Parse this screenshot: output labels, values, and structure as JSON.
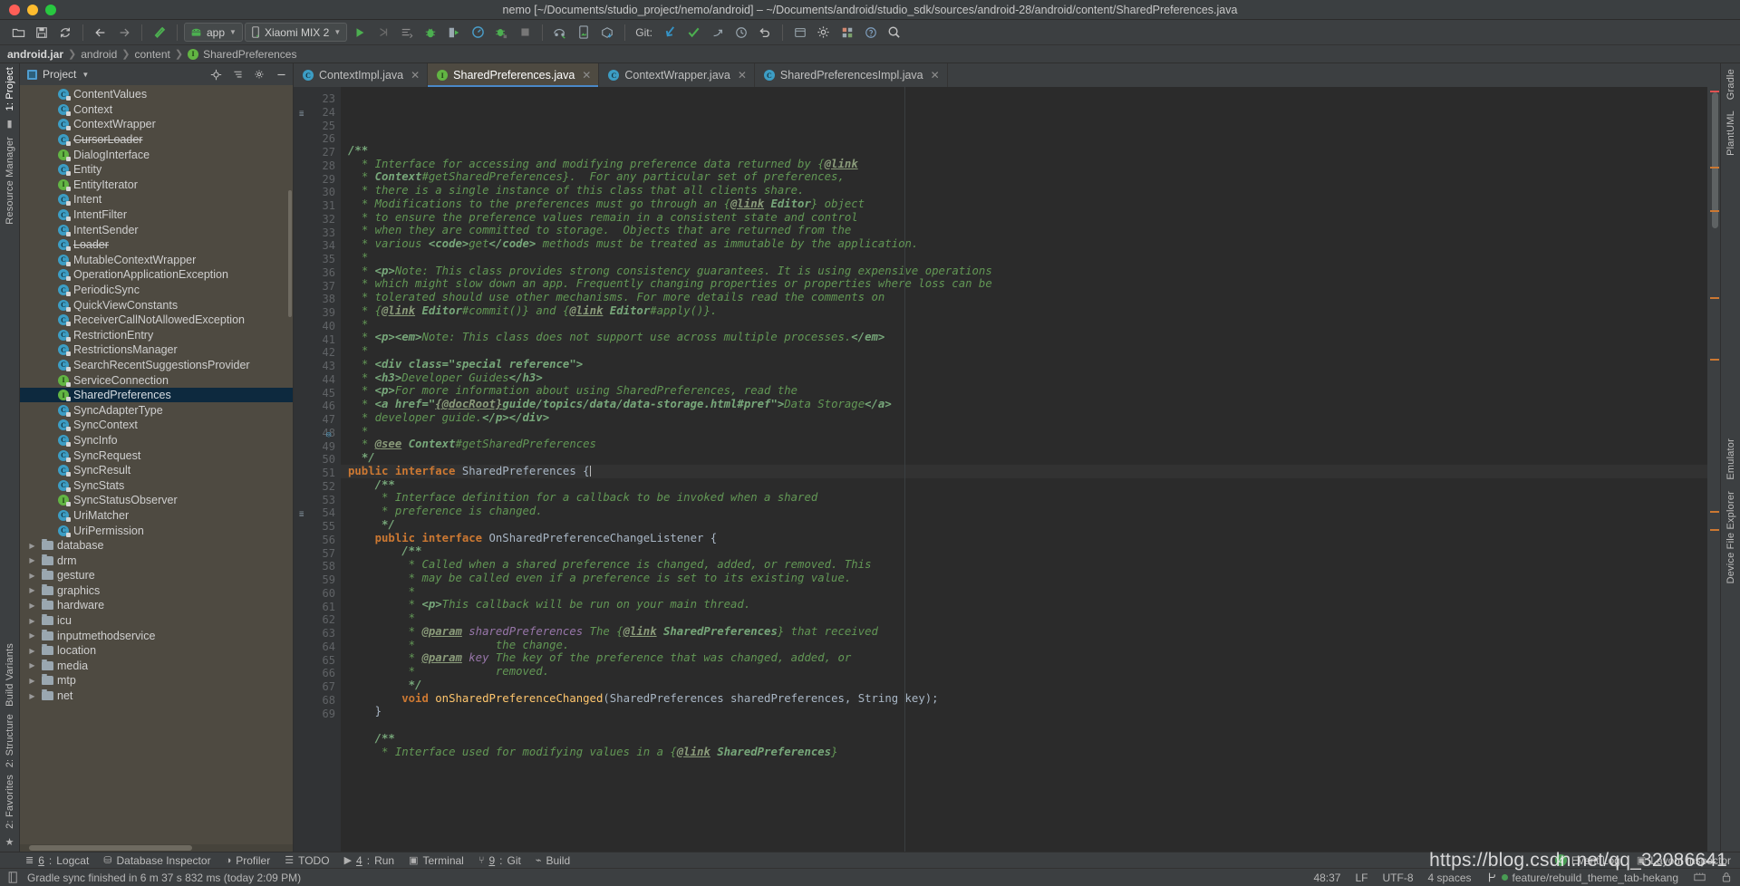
{
  "window": {
    "title": "nemo [~/Documents/studio_project/nemo/android] – ~/Documents/android/studio_sdk/sources/android-28/android/content/SharedPreferences.java"
  },
  "toolbar": {
    "icons": [
      "open-folder-icon",
      "save-icon",
      "sync-icon",
      "back-arrow-icon",
      "forward-arrow-icon",
      "build-hammer-icon"
    ],
    "module_selector": "app",
    "device_selector": "Xiaomi MIX 2",
    "run_icons": [
      "run-icon",
      "apply-changes-icon",
      "run-with-coverage-icon",
      "debug-icon",
      "attach-debugger-icon",
      "profiler-icon",
      "attach-debugger-android-icon",
      "stop-icon"
    ],
    "sdk_icons": [
      "sdk-manager-icon",
      "avd-manager-icon",
      "device-file-icon"
    ],
    "git_label": "Git:",
    "git_icons": [
      "update-project-icon",
      "commit-icon",
      "push-icon",
      "history-icon",
      "rollback-icon"
    ],
    "right_icons": [
      "search-everywhere-icon",
      "settings-gear-icon",
      "project-structure-icon",
      "help-icon",
      "search-icon"
    ]
  },
  "breadcrumb": {
    "items": [
      "android.jar",
      "android",
      "content",
      "SharedPreferences"
    ],
    "leaf_icon": "interface-icon"
  },
  "left_rail": {
    "top": [
      "1: Project",
      "Resource Manager"
    ],
    "bottom": [
      "Build Variants",
      "2: Structure",
      "2: Favorites"
    ]
  },
  "right_rail": {
    "items": [
      "Gradle",
      "PlantUML",
      "Emulator",
      "Device File Explorer"
    ]
  },
  "project_panel": {
    "title": "Project",
    "header_icons": [
      "locate-icon",
      "collapse-all-icon",
      "settings-icon",
      "hide-icon"
    ],
    "tree": [
      {
        "label": "ContentValues",
        "kind": "class",
        "indent": 2
      },
      {
        "label": "Context",
        "kind": "class",
        "indent": 2
      },
      {
        "label": "ContextWrapper",
        "kind": "class",
        "indent": 2
      },
      {
        "label": "CursorLoader",
        "kind": "class",
        "indent": 2,
        "deprecated": true
      },
      {
        "label": "DialogInterface",
        "kind": "interface",
        "indent": 2
      },
      {
        "label": "Entity",
        "kind": "class",
        "indent": 2
      },
      {
        "label": "EntityIterator",
        "kind": "interface",
        "indent": 2
      },
      {
        "label": "Intent",
        "kind": "class",
        "indent": 2
      },
      {
        "label": "IntentFilter",
        "kind": "class",
        "indent": 2
      },
      {
        "label": "IntentSender",
        "kind": "class",
        "indent": 2
      },
      {
        "label": "Loader",
        "kind": "class",
        "indent": 2,
        "deprecated": true
      },
      {
        "label": "MutableContextWrapper",
        "kind": "class",
        "indent": 2
      },
      {
        "label": "OperationApplicationException",
        "kind": "class",
        "indent": 2
      },
      {
        "label": "PeriodicSync",
        "kind": "class",
        "indent": 2
      },
      {
        "label": "QuickViewConstants",
        "kind": "class",
        "indent": 2
      },
      {
        "label": "ReceiverCallNotAllowedException",
        "kind": "class",
        "indent": 2
      },
      {
        "label": "RestrictionEntry",
        "kind": "class",
        "indent": 2
      },
      {
        "label": "RestrictionsManager",
        "kind": "class",
        "indent": 2
      },
      {
        "label": "SearchRecentSuggestionsProvider",
        "kind": "class",
        "indent": 2
      },
      {
        "label": "ServiceConnection",
        "kind": "interface",
        "indent": 2
      },
      {
        "label": "SharedPreferences",
        "kind": "interface",
        "indent": 2,
        "selected": true
      },
      {
        "label": "SyncAdapterType",
        "kind": "class",
        "indent": 2
      },
      {
        "label": "SyncContext",
        "kind": "class",
        "indent": 2
      },
      {
        "label": "SyncInfo",
        "kind": "class",
        "indent": 2
      },
      {
        "label": "SyncRequest",
        "kind": "class",
        "indent": 2
      },
      {
        "label": "SyncResult",
        "kind": "class",
        "indent": 2
      },
      {
        "label": "SyncStats",
        "kind": "class",
        "indent": 2
      },
      {
        "label": "SyncStatusObserver",
        "kind": "interface",
        "indent": 2
      },
      {
        "label": "UriMatcher",
        "kind": "class",
        "indent": 2
      },
      {
        "label": "UriPermission",
        "kind": "class",
        "indent": 2
      },
      {
        "label": "database",
        "kind": "folder",
        "indent": 1,
        "expandable": true
      },
      {
        "label": "drm",
        "kind": "folder",
        "indent": 1,
        "expandable": true
      },
      {
        "label": "gesture",
        "kind": "folder",
        "indent": 1,
        "expandable": true
      },
      {
        "label": "graphics",
        "kind": "folder",
        "indent": 1,
        "expandable": true
      },
      {
        "label": "hardware",
        "kind": "folder",
        "indent": 1,
        "expandable": true
      },
      {
        "label": "icu",
        "kind": "folder",
        "indent": 1,
        "expandable": true
      },
      {
        "label": "inputmethodservice",
        "kind": "folder",
        "indent": 1,
        "expandable": true
      },
      {
        "label": "location",
        "kind": "folder",
        "indent": 1,
        "expandable": true
      },
      {
        "label": "media",
        "kind": "folder",
        "indent": 1,
        "expandable": true
      },
      {
        "label": "mtp",
        "kind": "folder",
        "indent": 1,
        "expandable": true
      },
      {
        "label": "net",
        "kind": "folder",
        "indent": 1,
        "expandable": true
      }
    ]
  },
  "editor_tabs": [
    {
      "label": "ContextImpl.java",
      "kind": "class",
      "active": false
    },
    {
      "label": "SharedPreferences.java",
      "kind": "interface",
      "active": true
    },
    {
      "label": "ContextWrapper.java",
      "kind": "class",
      "active": false
    },
    {
      "label": "SharedPreferencesImpl.java",
      "kind": "class",
      "active": false
    }
  ],
  "code": {
    "first_line": 23,
    "lines": [
      {
        "n": 23,
        "html": ""
      },
      {
        "n": 24,
        "html": "<span class='cmt-b'>/**</span>",
        "fold": "-",
        "mark": true
      },
      {
        "n": 25,
        "html": "  <span class='cmt'>* Interface for accessing and modifying preference data returned by {</span><span class='tagl'>@link</span>"
      },
      {
        "n": 26,
        "html": "  <span class='cmt'>* </span><span class='cmt-b'>Context</span><span class='cmt'>#getSharedPreferences}.  For any particular set of preferences,</span>"
      },
      {
        "n": 27,
        "html": "  <span class='cmt'>* there is a single instance of this class that all clients share.</span>"
      },
      {
        "n": 28,
        "html": "  <span class='cmt'>* Modifications to the preferences must go through an {</span><span class='tagl'>@link</span><span class='cmt'> </span><span class='cmt-b'>Editor</span><span class='cmt'>} object</span>"
      },
      {
        "n": 29,
        "html": "  <span class='cmt'>* to ensure the preference values remain in a consistent state and control</span>"
      },
      {
        "n": 30,
        "html": "  <span class='cmt'>* when they are committed to storage.  Objects that are returned from the</span>"
      },
      {
        "n": 31,
        "html": "  <span class='cmt'>* various </span><span class='cmt-b'>&lt;code&gt;</span><span class='cmt'>get</span><span class='cmt-b'>&lt;/code&gt;</span><span class='cmt'> methods must be treated as immutable by the application.</span>"
      },
      {
        "n": 32,
        "html": "  <span class='cmt'>*</span>"
      },
      {
        "n": 33,
        "html": "  <span class='cmt'>* </span><span class='cmt-b'>&lt;p&gt;</span><span class='cmt'>Note: This class provides strong consistency guarantees. It is using expensive operations</span>"
      },
      {
        "n": 34,
        "html": "  <span class='cmt'>* which might slow down an app. Frequently changing properties or properties where loss can be</span>"
      },
      {
        "n": 35,
        "html": "  <span class='cmt'>* tolerated should use other mechanisms. For more details read the comments on</span>"
      },
      {
        "n": 36,
        "html": "  <span class='cmt'>* {</span><span class='tagl'>@link</span><span class='cmt'> </span><span class='cmt-b'>Editor</span><span class='cmt'>#commit()} and {</span><span class='tagl'>@link</span><span class='cmt'> </span><span class='cmt-b'>Editor</span><span class='cmt'>#apply()}.</span>"
      },
      {
        "n": 37,
        "html": "  <span class='cmt'>*</span>"
      },
      {
        "n": 38,
        "html": "  <span class='cmt'>* </span><span class='cmt-b'>&lt;p&gt;&lt;em&gt;</span><span class='cmt'>Note: This class does not support use across multiple processes.</span><span class='cmt-b'>&lt;/em&gt;</span>"
      },
      {
        "n": 39,
        "html": "  <span class='cmt'>*</span>"
      },
      {
        "n": 40,
        "html": "  <span class='cmt'>* </span><span class='cmt-b'>&lt;div class=\"special reference\"&gt;</span>"
      },
      {
        "n": 41,
        "html": "  <span class='cmt'>* </span><span class='cmt-b'>&lt;h3&gt;</span><span class='cmt'>Developer Guides</span><span class='cmt-b'>&lt;/h3&gt;</span>"
      },
      {
        "n": 42,
        "html": "  <span class='cmt'>* </span><span class='cmt-b'>&lt;p&gt;</span><span class='cmt'>For more information about using SharedPreferences, read the</span>"
      },
      {
        "n": 43,
        "html": "  <span class='cmt'>* </span><span class='cmt-b'>&lt;a href=\"</span><span class='tagl'>{@docRoot}</span><span class='cmt-b'>guide/topics/data/data-storage.html#pref\"&gt;</span><span class='cmt'>Data Storage</span><span class='cmt-b'>&lt;/a&gt;</span>"
      },
      {
        "n": 44,
        "html": "  <span class='cmt'>* developer guide.</span><span class='cmt-b'>&lt;/p&gt;&lt;/div&gt;</span>"
      },
      {
        "n": 45,
        "html": "  <span class='cmt'>*</span>"
      },
      {
        "n": 46,
        "html": "  <span class='cmt'>* </span><span class='tagl'>@see</span><span class='cmt'> </span><span class='cmt-b'>Context</span><span class='cmt'>#getSharedPreferences</span>"
      },
      {
        "n": 47,
        "html": "  <span class='cmt-b'>*/</span>"
      },
      {
        "n": 48,
        "html": "<span class='kw'>public interface </span><span class='typ'>SharedPreferences </span>{<span class='caret-line'></span>",
        "fold": "-",
        "current": true,
        "gmark": "impl"
      },
      {
        "n": 49,
        "html": "    <span class='cmt-b'>/**</span>",
        "fold": "-"
      },
      {
        "n": 50,
        "html": "     <span class='cmt'>* Interface definition for a callback to be invoked when a shared</span>"
      },
      {
        "n": 51,
        "html": "     <span class='cmt'>* preference is changed.</span>"
      },
      {
        "n": 52,
        "html": "     <span class='cmt-b'>*/</span>"
      },
      {
        "n": 53,
        "html": "    <span class='kw'>public interface </span><span class='typ'>OnSharedPreferenceChangeListener </span>{",
        "fold": "-"
      },
      {
        "n": 54,
        "html": "        <span class='cmt-b'>/**</span>",
        "fold": "-",
        "mark": true
      },
      {
        "n": 55,
        "html": "         <span class='cmt'>* Called when a shared preference is changed, added, or removed. This</span>"
      },
      {
        "n": 56,
        "html": "         <span class='cmt'>* may be called even if a preference is set to its existing value.</span>"
      },
      {
        "n": 57,
        "html": "         <span class='cmt'>*</span>"
      },
      {
        "n": 58,
        "html": "         <span class='cmt'>* </span><span class='cmt-b'>&lt;p&gt;</span><span class='cmt'>This callback will be run on your main thread.</span>"
      },
      {
        "n": 59,
        "html": "         <span class='cmt'>*</span>"
      },
      {
        "n": 60,
        "html": "         <span class='cmt'>* </span><span class='tagl'>@param</span><span class='cmt'> </span><span class='par'>sharedPreferences</span><span class='cmt'> The {</span><span class='tagl'>@link</span><span class='cmt'> </span><span class='cmt-b'>SharedPreferences</span><span class='cmt'>} that received</span>"
      },
      {
        "n": 61,
        "html": "         <span class='cmt'>*            the change.</span>"
      },
      {
        "n": 62,
        "html": "         <span class='cmt'>* </span><span class='tagl'>@param</span><span class='cmt'> </span><span class='par'>key</span><span class='cmt'> The key of the preference that was changed, added, or</span>"
      },
      {
        "n": 63,
        "html": "         <span class='cmt'>*            removed.</span>"
      },
      {
        "n": 64,
        "html": "         <span class='cmt-b'>*/</span>"
      },
      {
        "n": 65,
        "html": "        <span class='kw'>void </span><span class='fn'>onSharedPreferenceChanged</span>(<span class='typ'>SharedPreferences sharedPreferences</span>, <span class='typ'>String key</span>);"
      },
      {
        "n": 66,
        "html": "    }"
      },
      {
        "n": 67,
        "html": ""
      },
      {
        "n": 68,
        "html": "    <span class='cmt-b'>/**</span>",
        "fold": "-"
      },
      {
        "n": 69,
        "html": "     <span class='cmt'>* Interface used for modifying values in a {</span><span class='tagl'>@link</span><span class='cmt'> </span><span class='cmt-b'>SharedPreferences</span><span class='cmt'>}</span>"
      }
    ]
  },
  "tool_windows": {
    "left": [
      {
        "num": "6",
        "label": "Logcat",
        "icon": "logcat-icon"
      },
      {
        "num": "",
        "label": "Database Inspector",
        "icon": "database-icon"
      },
      {
        "num": "",
        "label": "Profiler",
        "icon": "profiler-icon"
      },
      {
        "num": "",
        "label": "TODO",
        "icon": "todo-icon"
      },
      {
        "num": "4",
        "label": "Run",
        "icon": "run-icon"
      },
      {
        "num": "",
        "label": "Terminal",
        "icon": "terminal-icon"
      },
      {
        "num": "9",
        "label": "Git",
        "icon": "git-icon"
      },
      {
        "num": "",
        "label": "Build",
        "icon": "build-icon"
      }
    ],
    "right": [
      {
        "label": "Event Log",
        "badge": "4",
        "icon": "event-log-icon"
      },
      {
        "label": "Layout Inspector",
        "badge": "",
        "icon": "layout-inspector-icon"
      }
    ]
  },
  "status_bar": {
    "message": "Gradle sync finished in 6 m 37 s 832 ms (today 2:09 PM)",
    "caret_position": "48:37",
    "line_separator": "LF",
    "encoding": "UTF-8",
    "indent": "4 spaces",
    "branch": "feature/rebuild_theme_tab-hekang",
    "right_icons": [
      "memory-icon",
      "lock-icon"
    ]
  },
  "watermark": "https://blog.csdn.net/qq_32086641",
  "colors": {
    "accent": "#4a88c7",
    "editor_bg": "#2b2b2b",
    "panel_bg": "#3c3f41",
    "tree_bg": "#4e4a41",
    "selection": "#0d293e",
    "comment": "#629755",
    "keyword": "#cc7832",
    "green": "#499c54"
  }
}
